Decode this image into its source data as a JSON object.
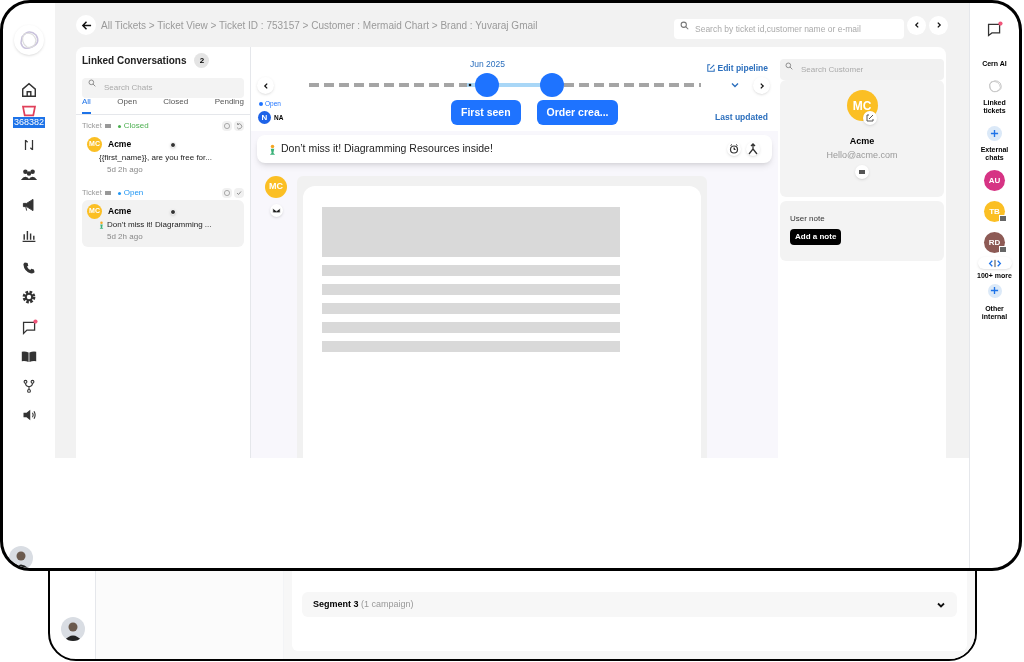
{
  "breadcrumb": "All Tickets > Ticket View > Ticket ID : 753157 > Customer : Mermaid Chart > Brand : Yuvaraj Gmail",
  "ticket_search": {
    "placeholder": "Search by ticket id,customer name or e-mail"
  },
  "nav_badge": "368382",
  "linked_conversations": {
    "title": "Linked Conversations",
    "count": "2",
    "search_placeholder": "Search Chats",
    "tabs": [
      {
        "label": "All",
        "selected": true
      },
      {
        "label": "Open",
        "selected": false
      },
      {
        "label": "Closed",
        "selected": false
      },
      {
        "label": "Pending",
        "selected": false
      }
    ],
    "tickets": [
      {
        "kind": "closed",
        "label": "Ticket",
        "status": "Closed",
        "color": "#4caf50",
        "avatar": "MC",
        "sender": "Acme",
        "preview": "{{first_name}}, are you free for...",
        "time": "5d 2h ago",
        "selected": false
      },
      {
        "kind": "open",
        "label": "Ticket",
        "status": "Open",
        "color": "#2196f3",
        "avatar": "MC",
        "sender": "Acme",
        "preview": "Don’t miss it! Diagramming ...",
        "time": "5d 2h ago",
        "selected": true
      }
    ]
  },
  "timeline": {
    "month": "Jun 2025",
    "edit": "Edit pipeline",
    "status": "Open",
    "agent_initial": "N",
    "agent": "NA",
    "stages": [
      "First seen",
      "Order crea..."
    ],
    "last_updated": "Last updated"
  },
  "subject": "Don’t miss it! Diagramming Resources inside!",
  "message": {
    "avatar": "MC"
  },
  "customer": {
    "search_placeholder": "Search Customer",
    "avatar": "MC",
    "name": "Acme",
    "email": "Hello@acme.com"
  },
  "note": {
    "title": "User note",
    "button": "Add a note"
  },
  "rail": {
    "cern_label": "Cern AI",
    "linked_label": "Linked tickets",
    "external_label": "External chats",
    "contacts": [
      {
        "initials": "AU",
        "color": "#d63384",
        "email": false
      },
      {
        "initials": "TB",
        "color": "#fbbf24",
        "email": true
      },
      {
        "initials": "RD",
        "color": "#8d5a55",
        "email": true
      }
    ],
    "more": "100+ more",
    "other_label": "Other internal"
  },
  "segment": {
    "title": "Segment 3",
    "count": "(1 campaign)"
  }
}
